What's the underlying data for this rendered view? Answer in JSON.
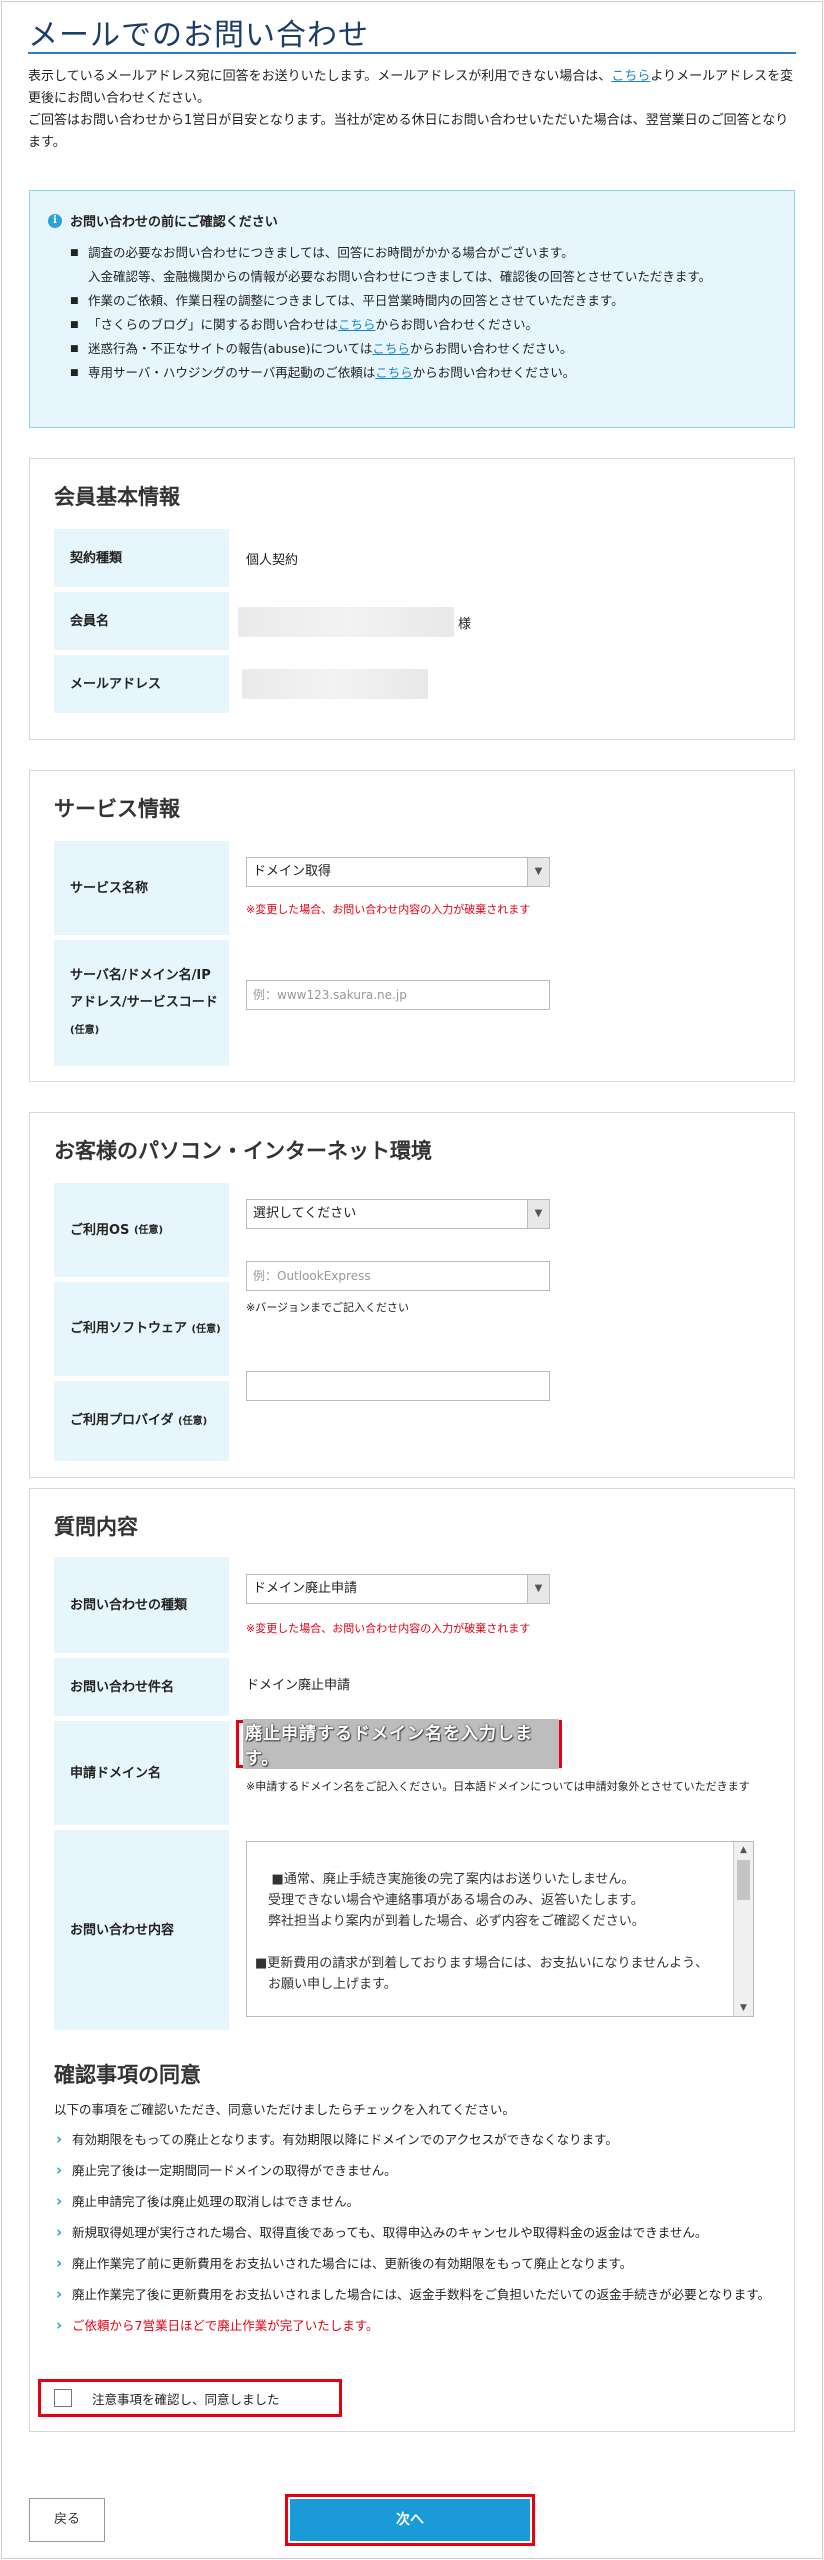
{
  "page": {
    "title": "メールでのお問い合わせ",
    "intro_line1_pre": "表示しているメールアドレス宛に回答をお送りいたします。メールアドレスが利用できない場合は、",
    "intro_link": "こちら",
    "intro_line1_post": "よりメールアドレスを変更後にお問い合わせください。",
    "intro_line2": "ご回答はお問い合わせから1営日が目安となります。当社が定める休日にお問い合わせいただいた場合は、翌営業日のご回答となります。"
  },
  "notice": {
    "heading": "お問い合わせの前にご確認ください",
    "items": [
      {
        "text": "調査の必要なお問い合わせにつきましては、回答にお時間がかかる場合がございます。"
      },
      {
        "text": "入金確認等、金融機関からの情報が必要なお問い合わせにつきましては、確認後の回答とさせていただきます。"
      },
      {
        "text": "作業のご依頼、作業日程の調整につきましては、平日営業時間内の回答とさせていただきます。"
      },
      {
        "pre": "「さくらのブログ」に関するお問い合わせは",
        "link": "こちら",
        "post": "からお問い合わせください。"
      },
      {
        "pre": "迷惑行為・不正なサイトの報告(abuse)については",
        "link": "こちら",
        "post": "からお問い合わせください。"
      },
      {
        "pre": "専用サーバ・ハウジングのサーバ再起動のご依頼は",
        "link": "こちら",
        "post": "からお問い合わせください。"
      }
    ]
  },
  "member": {
    "title": "会員基本情報",
    "contract_label": "契約種類",
    "contract_value": "個人契約",
    "name_label": "会員名",
    "name_suffix": "様",
    "email_label": "メールアドレス"
  },
  "service": {
    "title": "サービス情報",
    "service_name_label": "サービス名称",
    "service_name_value": "ドメイン取得",
    "service_name_warning": "※変更した場合、お問い合わせ内容の入力が破棄されます",
    "server_label": "サーバ名/ドメイン名/IPアドレス/サービスコード",
    "server_optional": "(任意)",
    "server_placeholder": "例：www123.sakura.ne.jp"
  },
  "environment": {
    "title": "お客様のパソコン・インターネット環境",
    "os_label": "ご利用OS",
    "os_optional": "(任意)",
    "os_value": "選択してください",
    "software_label": "ご利用ソフトウェア",
    "software_optional": "(任意)",
    "software_placeholder": "例：OutlookExpress",
    "software_note": "※バージョンまでご記入ください",
    "provider_label": "ご利用プロバイダ",
    "provider_optional": "(任意)"
  },
  "question": {
    "title": "質問内容",
    "type_label": "お問い合わせの種類",
    "type_value": "ドメイン廃止申請",
    "type_warning": "※変更した場合、お問い合わせ内容の入力が破棄されます",
    "subject_label": "お問い合わせ件名",
    "subject_value": "ドメイン廃止申請",
    "domain_label": "申請ドメイン名",
    "domain_banner": "廃止申請するドメイン名を入力します。",
    "domain_note": "※申請するドメイン名をご記入ください。日本語ドメインについては申請対象外とさせていただきます",
    "content_label": "お問い合わせ内容",
    "content_text": "■通常、廃止手続き実施後の完了案内はお送りいたしません。\n　受理できない場合や連絡事項がある場合のみ、返答いたします。\n　弊社担当より案内が到着した場合、必ず内容をご確認ください。\n\n■更新費用の請求が到着しております場合には、お支払いになりませんよう、\n　お願い申し上げます。\n\n　※廃止作業完了時に、お支払いの確認が取れておりません場合には、"
  },
  "agreement": {
    "title": "確認事項の同意",
    "lead": "以下の事項をご確認いただき、同意いただけましたらチェックを入れてください。",
    "items": [
      "有効期限をもっての廃止となります。有効期限以降にドメインでのアクセスができなくなります。",
      "廃止完了後は一定期間同一ドメインの取得ができません。",
      "廃止申請完了後は廃止処理の取消しはできません。",
      "新規取得処理が実行された場合、取得直後であっても、取得申込みのキャンセルや取得料金の返金はできません。",
      "廃止作業完了前に更新費用をお支払いされた場合には、更新後の有効期限をもって廃止となります。",
      "廃止作業完了後に更新費用をお支払いされました場合には、返金手数料をご負担いただいての返金手続きが必要となります。"
    ],
    "red_item": "ご依頼から7営業日ほどで廃止作業が完了いたします。",
    "checkbox_label": "注意事項を確認し、同意しました"
  },
  "buttons": {
    "back": "戻る",
    "next": "次へ"
  },
  "colors": {
    "accent": "#1a9bd7",
    "link": "#1a86c8",
    "warning": "#e60012",
    "label_bg": "#e7f6fc",
    "title": "#1b3d66"
  }
}
